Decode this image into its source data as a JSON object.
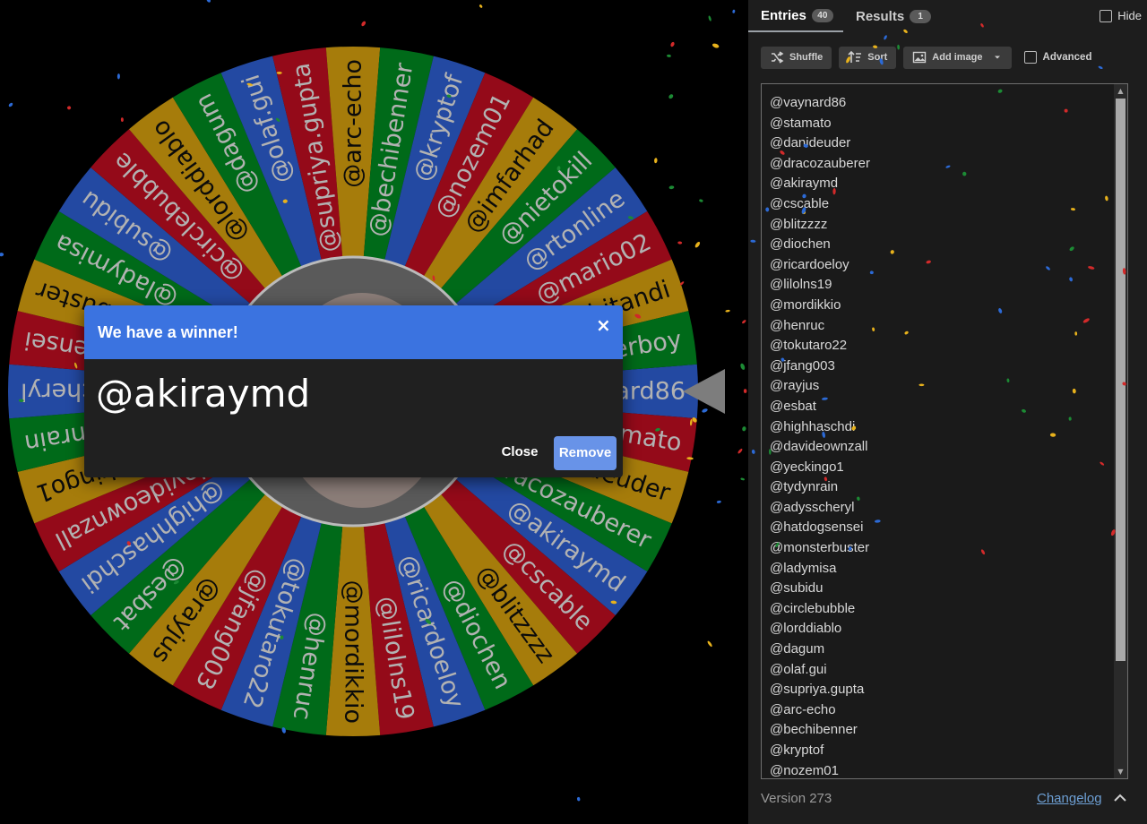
{
  "wheel": {
    "colors": [
      "#3369e8",
      "#d50f25",
      "#eeb211",
      "#009925"
    ],
    "slices": [
      "@vaynard86",
      "@stamato",
      "@danideuder",
      "@dracozauberer",
      "@akiraymd",
      "@cscable",
      "@blitzzzz",
      "@diochen",
      "@ricardoeloy",
      "@lilolns19",
      "@mordikkio",
      "@henruc",
      "@tokutaro22",
      "@jfang003",
      "@rayjus",
      "@esbat",
      "@highhaschdi",
      "@davideownzall",
      "@yeckingo1",
      "@tydynrain",
      "@adysscheryl",
      "@hatdogsensei",
      "@monsterbuster",
      "@ladymisa",
      "@subidu",
      "@circlebubble",
      "@lorddiablo",
      "@dagum",
      "@olaf.gui",
      "@supriya.gupta",
      "@arc-echo",
      "@bechibenner",
      "@kryptof",
      "@nozem01",
      "@imfarhad",
      "@nietokill",
      "@rtonline",
      "@mario02",
      "@bitandi",
      "@tinyouterboy"
    ]
  },
  "tabs": {
    "entries_label": "Entries",
    "entries_count": "40",
    "results_label": "Results",
    "results_count": "1",
    "hide_label": "Hide"
  },
  "toolbar": {
    "shuffle_label": "Shuffle",
    "sort_label": "Sort",
    "add_image_label": "Add image",
    "advanced_label": "Advanced"
  },
  "entries": [
    "@vaynard86",
    "@stamato",
    "@danideuder",
    "@dracozauberer",
    "@akiraymd",
    "@cscable",
    "@blitzzzz",
    "@diochen",
    "@ricardoeloy",
    "@lilolns19",
    "@mordikkio",
    "@henruc",
    "@tokutaro22",
    "@jfang003",
    "@rayjus",
    "@esbat",
    "@highhaschdi",
    "@davideownzall",
    "@yeckingo1",
    "@tydynrain",
    "@adysscheryl",
    "@hatdogsensei",
    "@monsterbuster",
    "@ladymisa",
    "@subidu",
    "@circlebubble",
    "@lorddiablo",
    "@dagum",
    "@olaf.gui",
    "@supriya.gupta",
    "@arc-echo",
    "@bechibenner",
    "@kryptof",
    "@nozem01"
  ],
  "footer": {
    "version": "Version 273",
    "changelog": "Changelog"
  },
  "dialog": {
    "title": "We have a winner!",
    "close_symbol": "×",
    "winner": "@akiraymd",
    "close_label": "Close",
    "remove_label": "Remove"
  },
  "confetti_colors": [
    "#e8b21c",
    "#2c6ad6",
    "#1c8a34",
    "#d22a2a"
  ]
}
